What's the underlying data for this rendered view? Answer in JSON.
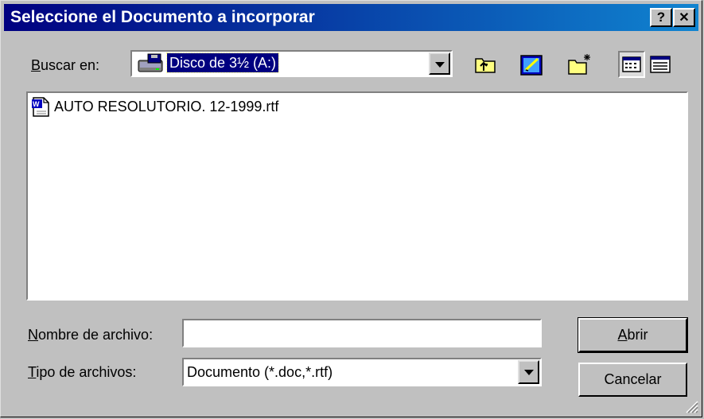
{
  "window": {
    "title": "Seleccione el Documento a incorporar",
    "help_button": "?",
    "close_button": "✕"
  },
  "look_in": {
    "label_underlined": "B",
    "label_rest": "uscar en:",
    "value": "Disco de 3½ (A:)",
    "drive_icon": "floppy-drive-icon"
  },
  "toolbar": {
    "icons": [
      "up-one-level-icon",
      "desktop-icon",
      "new-folder-icon",
      "list-view-icon",
      "details-view-icon"
    ]
  },
  "files": [
    {
      "name": "AUTO RESOLUTORIO. 12-1999.rtf",
      "icon": "word-document-icon"
    }
  ],
  "filename": {
    "label_underlined": "N",
    "label_rest": "ombre de archivo:",
    "value": ""
  },
  "filetype": {
    "label_underlined": "T",
    "label_rest": "ipo de archivos:",
    "value": "Documento (*.doc,*.rtf)"
  },
  "buttons": {
    "open_underlined": "A",
    "open_rest": "brir",
    "cancel": "Cancelar"
  },
  "colors": {
    "titlebar_start": "#000080",
    "titlebar_end": "#1084d0",
    "face": "#c0c0c0",
    "selection": "#000080"
  }
}
